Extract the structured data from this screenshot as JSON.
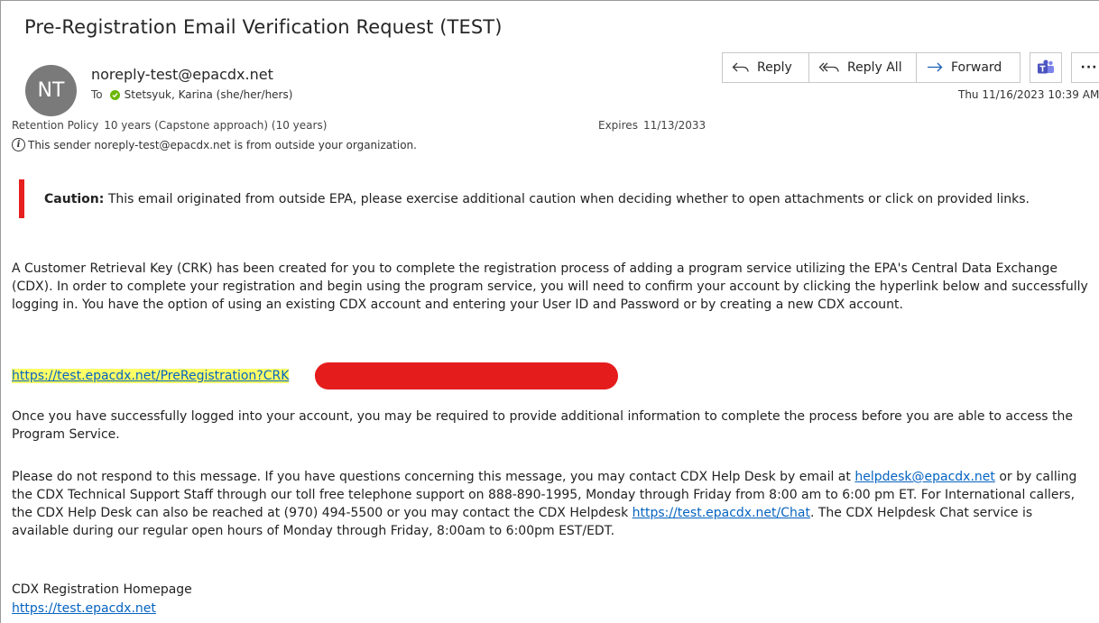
{
  "email": {
    "subject": "Pre-Registration Email Verification Request (TEST)",
    "avatar_initials": "NT",
    "from": "noreply-test@epacdx.net",
    "to_label": "To",
    "to_recipient": "Stetsyuk, Karina (she/her/hers)",
    "retention_label": "Retention Policy",
    "retention_value": "10 years (Capstone approach) (10 years)",
    "expires_label": "Expires",
    "expires_value": "11/13/2033",
    "outside_notice": "This sender noreply-test@epacdx.net is from outside your organization.",
    "datetime": "Thu 11/16/2023 10:39 AM"
  },
  "toolbar": {
    "reply_label": "Reply",
    "reply_all_label": "Reply All",
    "forward_label": "Forward",
    "more_label": "···"
  },
  "body": {
    "caution_bold": "Caution:",
    "caution_text": " This email originated from outside EPA, please exercise additional caution when deciding whether to open attachments or click on provided links.",
    "paragraph1": "A Customer Retrieval Key (CRK) has been created for you to complete the registration process of adding a program service utilizing the EPA's Central Data Exchange (CDX). In order to complete your registration and begin using the program service, you will need to confirm your account by clicking the hyperlink below and successfully logging in. You have the option of using an existing CDX account and entering your User ID and Password or by creating a new CDX account.",
    "crk_link": "https://test.epacdx.net/PreRegistration?CRK",
    "paragraph2": "Once you have successfully logged into your account, you may be required to provide additional information to complete the process before you are able to access the Program Service.",
    "p3_part1": "Please do not respond to this message. If you have questions concerning this message, you may contact CDX Help Desk by email at ",
    "helpdesk_email": "helpdesk@epacdx.net",
    "p3_part2": " or by calling the CDX Technical Support Staff through our toll free telephone support on 888-890-1995, Monday through Friday from 8:00 am to 6:00 pm ET. For International callers, the CDX Help Desk can also be reached at (970) 494-5500 or you may contact the CDX Helpdesk ",
    "chat_link": "https://test.epacdx.net/Chat",
    "p3_part3": ". The CDX Helpdesk Chat service is available during our regular open hours of Monday through Friday, 8:00am to 6:00pm EST/EDT.",
    "homepage_title": "CDX Registration Homepage",
    "homepage_link": "https://test.epacdx.net"
  },
  "colors": {
    "caution_bar": "#e61e1e",
    "link": "#0563c1",
    "highlight": "#ffff66",
    "redaction": "#e51c1c",
    "presence_green": "#6bb700",
    "avatar_bg": "#7a7a7a"
  }
}
